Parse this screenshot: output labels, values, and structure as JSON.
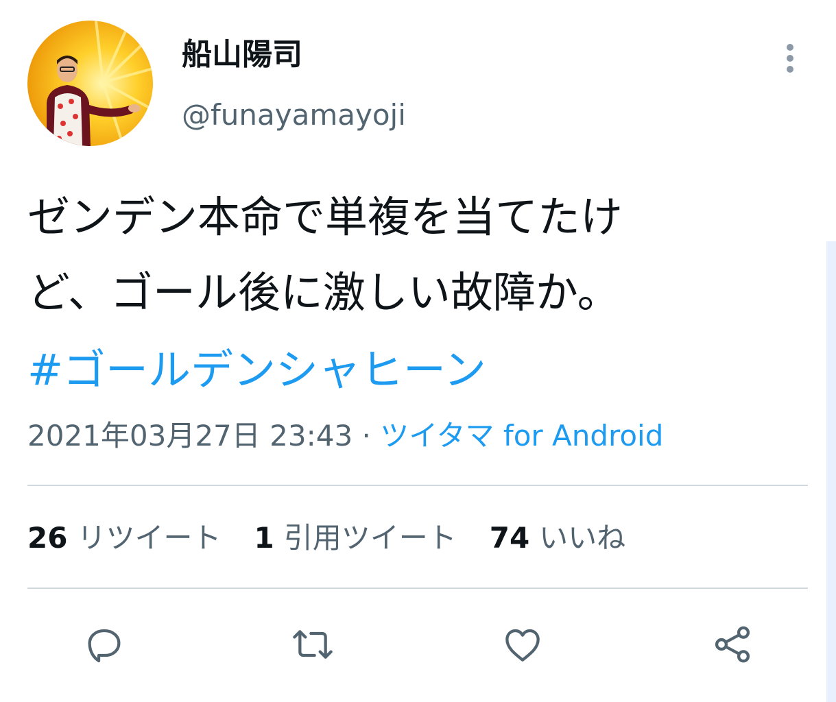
{
  "user": {
    "display_name": "船山陽司",
    "handle": "@funayamayoji"
  },
  "tweet": {
    "text_lines": [
      "ゼンデン本命で単複を当てたけ",
      "ど、ゴール後に激しい故障か。"
    ],
    "hashtag": "#ゴールデンシャヒーン",
    "timestamp": "2021年03月27日 23:43",
    "separator": " · ",
    "source": "ツイタマ for Android"
  },
  "stats": {
    "retweets": {
      "count": "26",
      "label": "リツイート"
    },
    "quotes": {
      "count": "1",
      "label": "引用ツイート"
    },
    "likes": {
      "count": "74",
      "label": "いいね"
    }
  },
  "actions": [
    {
      "icon": "reply-icon"
    },
    {
      "icon": "retweet-icon"
    },
    {
      "icon": "like-icon"
    },
    {
      "icon": "share-icon"
    }
  ],
  "colors": {
    "text": "#0f1419",
    "secondary": "#536471",
    "link": "#1d9bf0",
    "divider": "#cfd9de"
  }
}
